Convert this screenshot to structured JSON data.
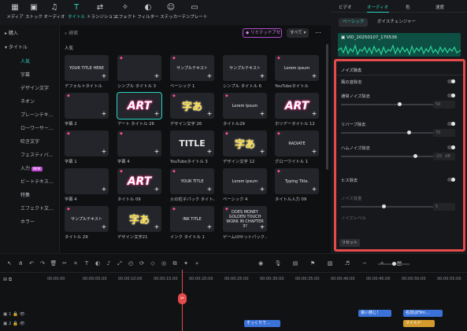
{
  "toolbar": {
    "items": [
      {
        "label": "メディア",
        "icon": "media-icon"
      },
      {
        "label": "ストック",
        "icon": "stock-icon"
      },
      {
        "label": "オーディオ",
        "icon": "music-note-icon"
      },
      {
        "label": "タイトル",
        "icon": "title-icon",
        "active": true
      },
      {
        "label": "トランジション",
        "icon": "transition-icon"
      },
      {
        "label": "エフェクト",
        "icon": "effect-icon"
      },
      {
        "label": "フィルター",
        "icon": "filter-icon"
      },
      {
        "label": "ステッカー",
        "icon": "sticker-icon"
      },
      {
        "label": "テンプレート",
        "icon": "template-icon"
      }
    ]
  },
  "sidebar": {
    "items": [
      {
        "label": "購入",
        "level": "main"
      },
      {
        "label": "タイトル",
        "level": "main"
      },
      {
        "label": "人気",
        "level": "sub",
        "selected": true
      },
      {
        "label": "字幕",
        "level": "sub"
      },
      {
        "label": "デザイン文字",
        "level": "sub"
      },
      {
        "label": "ネオン",
        "level": "sub"
      },
      {
        "label": "プレーンテキ…",
        "level": "sub"
      },
      {
        "label": "ローワーサー…",
        "level": "sub"
      },
      {
        "label": "吹き文字",
        "level": "sub"
      },
      {
        "label": "フェスティバ…",
        "level": "sub"
      },
      {
        "label": "入力",
        "level": "sub",
        "badge": "NEW"
      },
      {
        "label": "ビートテキス…",
        "level": "sub"
      },
      {
        "label": "特集",
        "level": "sub"
      },
      {
        "label": "エフェクト文…",
        "level": "sub"
      },
      {
        "label": "ホラー",
        "level": "sub"
      }
    ]
  },
  "gallery": {
    "search_placeholder": "検索",
    "promo_label": "リミテッドアセ",
    "filter_label": "すべて",
    "section_title": "人気",
    "tiles": [
      {
        "caption": "デフォルトタイトル",
        "thumb": "YOUR TITLE HERE"
      },
      {
        "caption": "シンプル タイトル 3",
        "thumb": ""
      },
      {
        "caption": "ベーシック 1",
        "thumb": "サンプルテキスト"
      },
      {
        "caption": "シンプル タイトル 6",
        "thumb": "サンプルテキスト"
      },
      {
        "caption": "YouTubeタイトル",
        "thumb": "Lorem ipsum"
      },
      {
        "caption": "字幕 2",
        "thumb": ""
      },
      {
        "caption": "アート タイトル 26",
        "thumb": "ART",
        "selected": true
      },
      {
        "caption": "デザイン文字 26",
        "thumb": "字あ"
      },
      {
        "caption": "タイトル29",
        "thumb": "Lorem Ipsum"
      },
      {
        "caption": "ホリデータイトル 12",
        "thumb": "ART"
      },
      {
        "caption": "字幕 1",
        "thumb": ""
      },
      {
        "caption": "字幕 4",
        "thumb": ""
      },
      {
        "caption": "YouTubeタイトル 3",
        "thumb": "TITLE"
      },
      {
        "caption": "デザイン文字 12",
        "thumb": "字あ"
      },
      {
        "caption": "グローワイトル 1",
        "thumb": "RADIATE"
      },
      {
        "caption": "字幕 4",
        "thumb": ""
      },
      {
        "caption": "タイトル 09",
        "thumb": "ART"
      },
      {
        "caption": "火の粒子パック タイトル 1",
        "thumb": "YOUR TITLE"
      },
      {
        "caption": "ベーシック 4",
        "thumb": "Lorem ipsum"
      },
      {
        "caption": "タイトル入力 09",
        "thumb": "Typing Title."
      },
      {
        "caption": "タイトル 29",
        "thumb": "サンプルテキスト"
      },
      {
        "caption": "デザイン文字21",
        "thumb": "字あ"
      },
      {
        "caption": "インク タイトル 1",
        "thumb": "INK TITLE"
      },
      {
        "caption": "ゲームUIセットパック…",
        "thumb": "DOES MONEY GOLDEN TOUCH WORK IN CHAPTER 3?"
      }
    ]
  },
  "right": {
    "tabs": [
      "ビデオ",
      "オーディオ",
      "色",
      "速度"
    ],
    "subtabs": [
      "ベーシック",
      "ボイスチェンジャー"
    ],
    "clip_name": "VID_20250107_170536",
    "noise": {
      "title": "ノイズ除去",
      "rows": [
        {
          "label": "風の音除去",
          "type": "toggle"
        },
        {
          "label": "通常ノイズ除去",
          "type": "toggle",
          "value": "50",
          "level": 0.62
        },
        {
          "label": "リバーブ除去",
          "type": "toggle",
          "value": "70",
          "level": 0.72
        },
        {
          "label": "ハムノイズ除去",
          "type": "toggle",
          "value": "-25",
          "unit": "dB",
          "level": 0.78
        },
        {
          "label": "ヒス除去",
          "type": "toggle"
        },
        {
          "label": "ノイズ音量",
          "type": "dim",
          "value": "5",
          "level": 0.45
        },
        {
          "label": "ノイズレベル",
          "type": "dim"
        }
      ],
      "reset_label": "リセット"
    }
  },
  "timeline": {
    "ticks": [
      "00:00:00",
      "00:00:05:00",
      "00:00:10:00",
      "00:00:15:00",
      "00:00:20:00",
      "00:00:25:00",
      "00:00:30:00",
      "00:00:35:00",
      "00:00:40:00",
      "00:00:45:00",
      "00:00:50:00",
      "00:00:55:00"
    ],
    "clips": [
      {
        "label": "そっくりで…",
        "color": "#3a72d8"
      },
      {
        "label": "良い感じ！",
        "color": "#3a72d8"
      },
      {
        "label": "名前はFilm…",
        "color": "#3a72d8"
      },
      {
        "label": "マイルド",
        "color": "#d29b2b"
      }
    ]
  }
}
